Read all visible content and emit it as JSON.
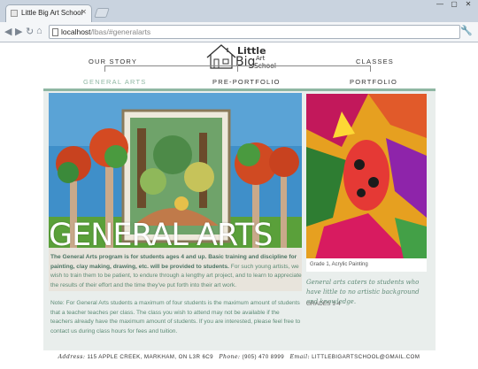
{
  "browser": {
    "tab_title": "Little Big Art School",
    "url_host": "localhost",
    "url_path": "/lbas/#generalarts",
    "icons": [
      "back-icon",
      "forward-icon",
      "reload-icon",
      "home-icon",
      "wrench-icon",
      "close-icon",
      "minimize-icon",
      "maximize-icon"
    ]
  },
  "logo": {
    "line1": "Little",
    "line2": "Big",
    "line3": "Art",
    "line4": "School"
  },
  "nav": {
    "our_story": "OUR STORY",
    "classes": "CLASSES",
    "general_arts": "GENERAL ARTS",
    "pre_portfolio": "PRE-PORTFOLIO",
    "portfolio": "PORTFOLIO"
  },
  "hero": {
    "title": "GENERAL ARTS"
  },
  "side": {
    "caption": "Grade 1, Acrylic Painting",
    "tagline": "General arts caters to students who have little to no artistic background and knowledge.",
    "grades": "GRADES 1-4"
  },
  "body": {
    "p1_bold": "The General Arts program is for students ages 4 and up. Basic training and discipline for painting, clay making, drawing, etc. will be provided to students.",
    "p1_rest": " For such young artists, we wish to train them to be patient, to endure through a lengthy art project, and to learn to appreciate the results of their effort and the time they've put forth into their art work.",
    "p2": "Note: For General Arts students a maximum of four students is the maximum amount of students that a teacher teaches per class. The class you wish to attend may not be available if the teachers already have the maximum amount of students. If you are interested, please feel free to contact us during class hours for fees and tuition."
  },
  "footer": {
    "address_label": "Address:",
    "address": "115 APPLE CREEK, MARKHAM, ON L3R 6C9",
    "phone_label": "Phone:",
    "phone": "(905) 470 8999",
    "email_label": "Email:",
    "email": "LITTLEBIGARTSCHOOL@GMAIL.COM"
  },
  "colors": {
    "accent": "#8fb7a3",
    "panel": "#e9eeec",
    "text": "#5b8a74"
  }
}
